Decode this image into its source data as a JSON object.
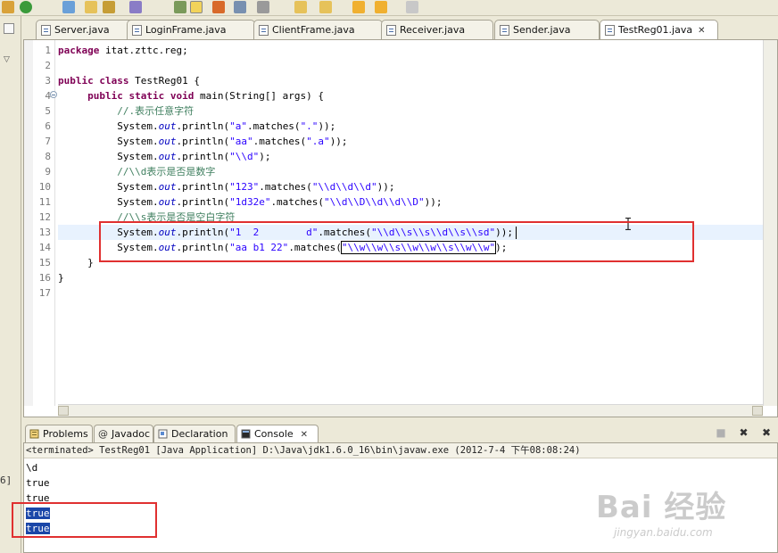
{
  "editor_tabs": [
    {
      "label": "Server.java"
    },
    {
      "label": "LoginFrame.java"
    },
    {
      "label": "ClientFrame.java"
    },
    {
      "label": "Receiver.java"
    },
    {
      "label": "Sender.java"
    },
    {
      "label": "TestReg01.java",
      "active": true,
      "close": "✕"
    }
  ],
  "line_numbers": [
    "1",
    "2",
    "3",
    "4",
    "5",
    "6",
    "7",
    "8",
    "9",
    "10",
    "11",
    "12",
    "13",
    "14",
    "15",
    "16",
    "17"
  ],
  "code": {
    "l1_kw": "package",
    "l1_rest": " itat.zttc.reg;",
    "l3_kw": "public class",
    "l3_rest": " TestReg01 {",
    "l4_kw": "public static void",
    "l4_rest": " main(String[] args) {",
    "l5_comment": "//.表示任意字符",
    "sys": "System.",
    "out": "out",
    "l6_a": ".println(",
    "l6_s1": "\"a\"",
    "l6_b": ".matches(",
    "l6_s2": "\".\"",
    "l6_c": "));",
    "l7_s1": "\"aa\"",
    "l7_s2": "\".a\"",
    "l8_s1": "\"\\\\d\"",
    "l8_c": ");",
    "l9_comment": "//\\\\d表示是否是数字",
    "l10_s1": "\"123\"",
    "l10_s2": "\"\\\\d\\\\d\\\\d\"",
    "l11_s1": "\"1d32e\"",
    "l11_s2": "\"\\\\d\\\\D\\\\d\\\\d\\\\D\"",
    "l12_comment": "//\\\\s表示是否是空白字符",
    "l13_s1": "\"1  2        d\"",
    "l13_s2": "\"\\\\d\\\\s\\\\s\\\\d\\\\s\\\\sd\"",
    "l14_s1": "\"aa b1 22\"",
    "l14_s2": "\"\\\\w\\\\w\\\\s\\\\w\\\\w\\\\s\\\\w\\\\w\"",
    "l14_c": ");",
    "l15": "}",
    "l16": "}"
  },
  "panel_tabs": [
    {
      "label": "Problems",
      "icon": "problems-icon"
    },
    {
      "label": "Javadoc",
      "icon": "at-icon"
    },
    {
      "label": "Declaration",
      "icon": "declaration-icon"
    },
    {
      "label": "Console",
      "icon": "console-icon",
      "active": true,
      "close": "✕"
    }
  ],
  "console": {
    "header": "<terminated> TestReg01 [Java Application] D:\\Java\\jdk1.6.0_16\\bin\\javaw.exe (2012-7-4 下午08:08:24)",
    "lines": [
      "\\d",
      "true",
      "true",
      "true",
      "true"
    ]
  },
  "left_strip_number": "6]",
  "watermark": {
    "logo": "Bai  经验",
    "sub": "jingyan.baidu.com"
  },
  "colors": {
    "keyword": "#7f0055",
    "string": "#2a00ff",
    "comment": "#3f7f5f",
    "field": "#0000c0",
    "annotation_box": "#e03030",
    "selection": "#1a46a8"
  }
}
